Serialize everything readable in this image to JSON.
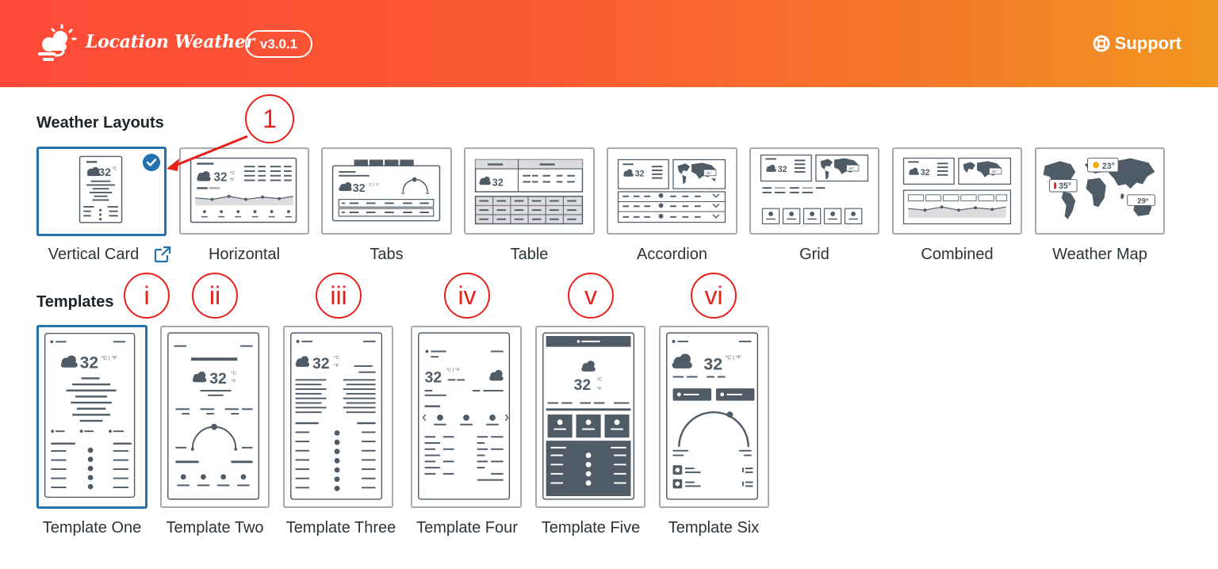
{
  "header": {
    "app_name": "Location Weather",
    "version": "v3.0.1",
    "support_label": "Support",
    "icon": "weather-logo-icon"
  },
  "colors": {
    "header_start": "#fd4a38",
    "header_end": "#f1961f",
    "accent": "#2271b1",
    "callout": "#e8201a",
    "wire": "#4f5b66"
  },
  "layouts": {
    "title": "Weather Layouts",
    "selected": "Vertical Card",
    "items": [
      {
        "label": "Vertical Card"
      },
      {
        "label": "Horizontal"
      },
      {
        "label": "Tabs"
      },
      {
        "label": "Table"
      },
      {
        "label": "Accordion"
      },
      {
        "label": "Grid"
      },
      {
        "label": "Combined"
      },
      {
        "label": "Weather Map"
      }
    ]
  },
  "templates": {
    "title": "Templates",
    "selected": "Template One",
    "items": [
      {
        "label": "Template One"
      },
      {
        "label": "Template Two"
      },
      {
        "label": "Template Three"
      },
      {
        "label": "Template Four"
      },
      {
        "label": "Template Five"
      },
      {
        "label": "Template Six"
      }
    ]
  },
  "previews": {
    "temp": "32",
    "unit_c": "°C",
    "unit_f": "°F",
    "unit_cf": "°C | °F",
    "map_temps": [
      "23°",
      "35°",
      "29°"
    ],
    "small_temp": "35°"
  },
  "callouts": {
    "layout_marker": "1",
    "template_markers": [
      "i",
      "ii",
      "iii",
      "iv",
      "v",
      "vi"
    ]
  }
}
